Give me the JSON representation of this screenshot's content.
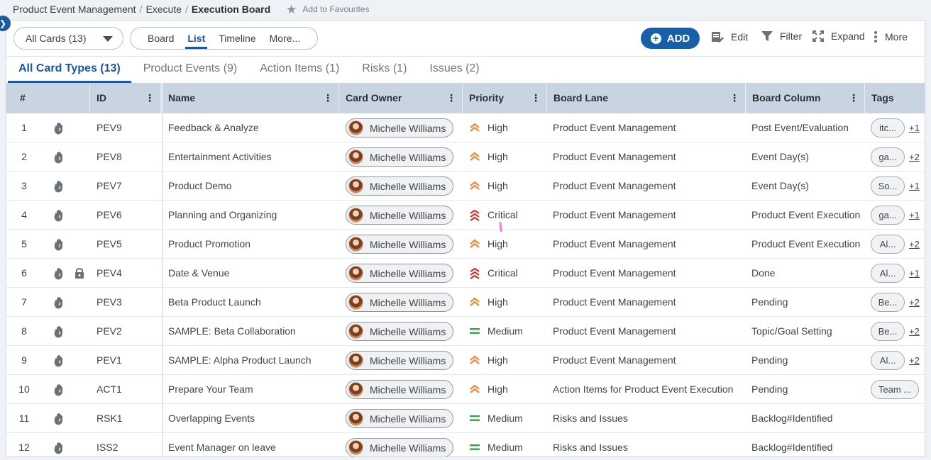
{
  "breadcrumb": {
    "items": [
      "Product Event Management",
      "Execute",
      "Execution Board"
    ],
    "separator": "/",
    "favourite_label": "Add to Favourites"
  },
  "toolbar": {
    "cards_filter": "All Cards (13)",
    "views": [
      "Board",
      "List",
      "Timeline",
      "More..."
    ],
    "active_view": "List",
    "add_label": "ADD",
    "edit_label": "Edit",
    "filter_label": "Filter",
    "expand_label": "Expand",
    "more_label": "More"
  },
  "type_tabs": [
    "All Card Types (13)",
    "Product Events (9)",
    "Action Items (1)",
    "Risks (1)",
    "Issues (2)"
  ],
  "columns": {
    "num": "#",
    "id": "ID",
    "name": "Name",
    "owner": "Card Owner",
    "priority": "Priority",
    "lane": "Board Lane",
    "column": "Board Column",
    "tags": "Tags"
  },
  "colors": {
    "primary": "#175fa8",
    "header_bg": "#c8d4e2",
    "high": "#f08a3c",
    "critical": "#d32f2f",
    "medium": "#3aa34a"
  },
  "rows": [
    {
      "num": "1",
      "id": "PEV9",
      "name": "Feedback & Analyze",
      "owner": "Michelle Williams",
      "priority": "High",
      "lane": "Product Event Management",
      "column": "Post Event/Evaluation",
      "tag": "itc...",
      "more": "+1",
      "locked": false
    },
    {
      "num": "2",
      "id": "PEV8",
      "name": "Entertainment Activities",
      "owner": "Michelle Williams",
      "priority": "High",
      "lane": "Product Event Management",
      "column": "Event Day(s)",
      "tag": "ga...",
      "more": "+2",
      "locked": false
    },
    {
      "num": "3",
      "id": "PEV7",
      "name": "Product Demo",
      "owner": "Michelle Williams",
      "priority": "High",
      "lane": "Product Event Management",
      "column": "Event Day(s)",
      "tag": "So...",
      "more": "+1",
      "locked": false
    },
    {
      "num": "4",
      "id": "PEV6",
      "name": "Planning and Organizing",
      "owner": "Michelle Williams",
      "priority": "Critical",
      "lane": "Product Event Management",
      "column": "Product Event Execution",
      "tag": "ga...",
      "more": "+1",
      "locked": false
    },
    {
      "num": "5",
      "id": "PEV5",
      "name": "Product Promotion",
      "owner": "Michelle Williams",
      "priority": "High",
      "lane": "Product Event Management",
      "column": "Product Event Execution",
      "tag": "Al...",
      "more": "+2",
      "locked": false
    },
    {
      "num": "6",
      "id": "PEV4",
      "name": "Date & Venue",
      "owner": "Michelle Williams",
      "priority": "Critical",
      "lane": "Product Event Management",
      "column": "Done",
      "tag": "Al...",
      "more": "+1",
      "locked": true
    },
    {
      "num": "7",
      "id": "PEV3",
      "name": "Beta Product Launch",
      "owner": "Michelle Williams",
      "priority": "High",
      "lane": "Product Event Management",
      "column": "Pending",
      "tag": "Be...",
      "more": "+2",
      "locked": false
    },
    {
      "num": "8",
      "id": "PEV2",
      "name": "SAMPLE: Beta Collaboration",
      "owner": "Michelle Williams",
      "priority": "Medium",
      "lane": "Product Event Management",
      "column": "Topic/Goal Setting",
      "tag": "Be...",
      "more": "+2",
      "locked": false
    },
    {
      "num": "9",
      "id": "PEV1",
      "name": "SAMPLE: Alpha Product Launch",
      "owner": "Michelle Williams",
      "priority": "High",
      "lane": "Product Event Management",
      "column": "Pending",
      "tag": "Al...",
      "more": "+2",
      "locked": false
    },
    {
      "num": "10",
      "id": "ACT1",
      "name": "Prepare Your Team",
      "owner": "Michelle Williams",
      "priority": "High",
      "lane": "Action Items for Product Event Execution",
      "column": "Pending",
      "tag": "Team ...",
      "more": "",
      "locked": false
    },
    {
      "num": "11",
      "id": "RSK1",
      "name": "Overlapping Events",
      "owner": "Michelle Williams",
      "priority": "Medium",
      "lane": "Risks and Issues",
      "column": "Backlog#Identified",
      "tag": "",
      "more": "",
      "locked": false
    },
    {
      "num": "12",
      "id": "ISS2",
      "name": "Event Manager on leave",
      "owner": "Michelle Williams",
      "priority": "Medium",
      "lane": "Risks and Issues",
      "column": "Backlog#Identified",
      "tag": "",
      "more": "",
      "locked": false
    }
  ]
}
